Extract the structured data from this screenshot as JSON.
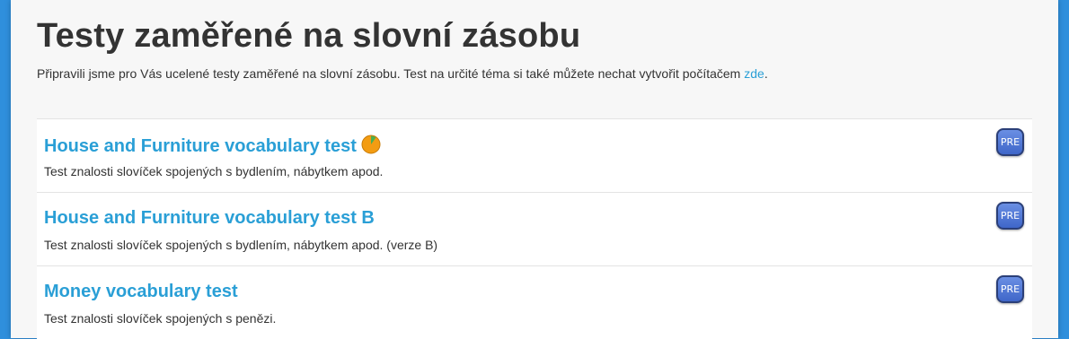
{
  "page": {
    "title": "Testy zaměřené na slovní zásobu",
    "intro_text": "Připravili jsme pro Vás ucelené testy zaměřené na slovní zásobu. Test na určité téma si také můžete nechat vytvořit počítačem ",
    "intro_link": "zde",
    "intro_suffix": "."
  },
  "tests": [
    {
      "title": "House and Furniture vocabulary test",
      "description": "Test znalosti slovíček spojených s bydlením, nábytkem apod.",
      "level": "PRE",
      "has_progress_icon": true,
      "progress_icon": "pie-progress-icon",
      "progress_colors": {
        "filled": "#4caf50",
        "remaining": "#f39c12"
      }
    },
    {
      "title": "House and Furniture vocabulary test B",
      "description": "Test znalosti slovíček spojených s bydlením, nábytkem apod. (verze B)",
      "level": "PRE",
      "has_progress_icon": false
    },
    {
      "title": "Money vocabulary test",
      "description": "Test znalosti slovíček spojených s penězi.",
      "level": "PRE",
      "has_progress_icon": false
    }
  ],
  "colors": {
    "background": "#2f8fdc",
    "panel": "#f7f7f7",
    "link": "#2a9fd6",
    "badge": "#4f73d4"
  }
}
